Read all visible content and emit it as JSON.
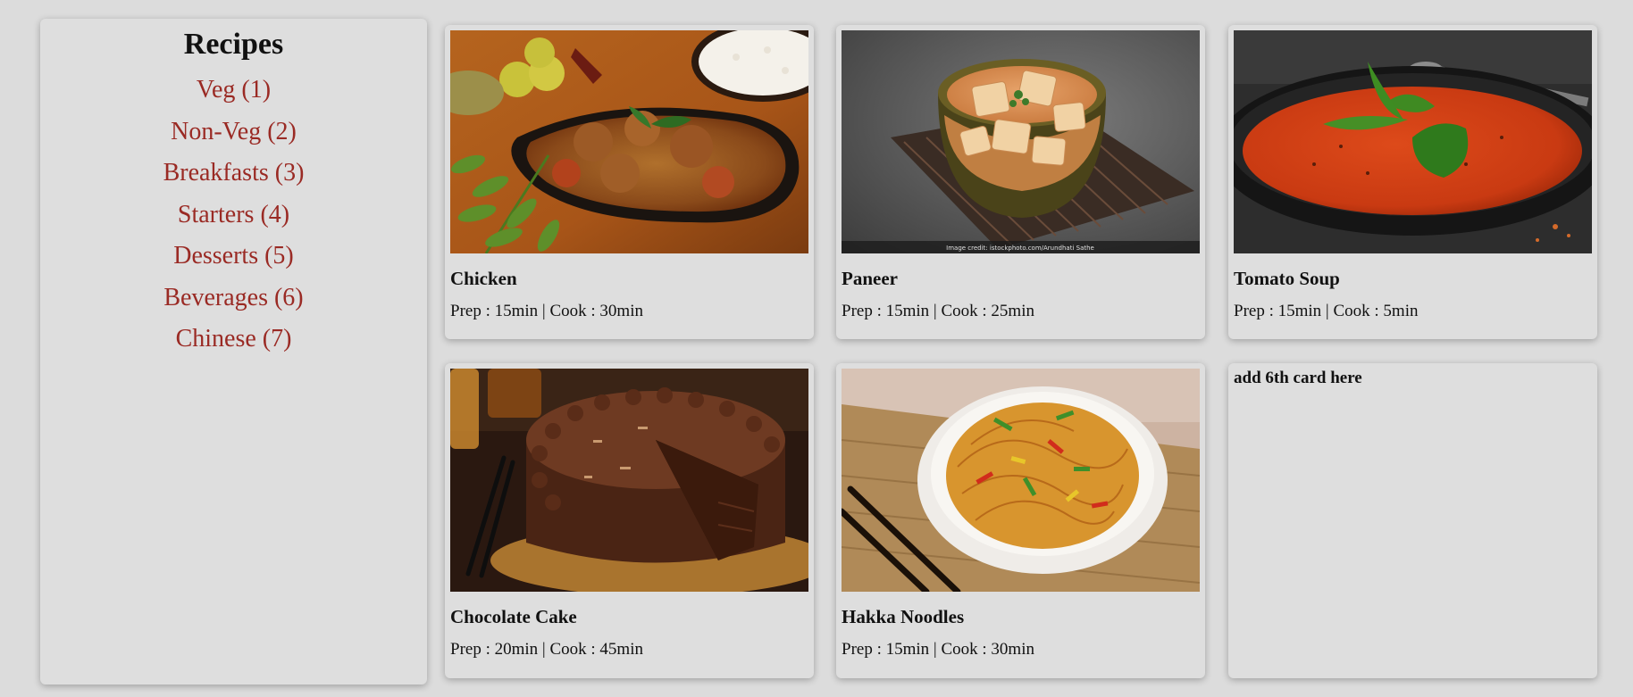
{
  "sidebar": {
    "title": "Recipes",
    "categories": [
      "Veg (1)",
      "Non-Veg (2)",
      "Breakfasts (3)",
      "Starters (4)",
      "Desserts (5)",
      "Beverages (6)",
      "Chinese (7)"
    ]
  },
  "cards": [
    {
      "title": "Chicken",
      "meta": "Prep : 15min | Cook : 30min",
      "image": "chicken-curry-photo"
    },
    {
      "title": "Paneer",
      "meta": "Prep : 15min | Cook : 25min",
      "image": "paneer-curry-photo",
      "image_credit": "Image credit: istockphoto.com/Arundhati Sathe"
    },
    {
      "title": "Tomato Soup",
      "meta": "Prep : 15min | Cook : 5min",
      "image": "tomato-soup-photo"
    },
    {
      "title": "Chocolate Cake",
      "meta": "Prep : 20min | Cook : 45min",
      "image": "chocolate-cake-photo"
    },
    {
      "title": "Hakka Noodles",
      "meta": "Prep : 15min | Cook : 30min",
      "image": "hakka-noodles-photo"
    }
  ],
  "placeholder_card": {
    "text": "add 6th card here"
  },
  "colors": {
    "background": "#dcdcdc",
    "panel": "#dedede",
    "category_link": "#9a2a24",
    "text": "#111111"
  }
}
